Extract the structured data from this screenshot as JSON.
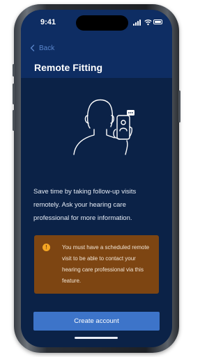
{
  "status_bar": {
    "time": "9:41"
  },
  "nav": {
    "back_label": "Back"
  },
  "page": {
    "title": "Remote Fitting"
  },
  "main": {
    "description": "Save time by taking follow-up visits remotely. Ask your hearing care professional for more information."
  },
  "warning": {
    "icon": "!",
    "text": "You must have a scheduled remote visit to be able to contact your hearing care professional via this feature."
  },
  "actions": {
    "create_account_label": "Create account"
  },
  "colors": {
    "header_bg": "#0e2d63",
    "screen_bg": "#0b2247",
    "accent_blue": "#3d74c9",
    "warning_bg": "#7d4512",
    "warning_icon": "#f5a623"
  }
}
